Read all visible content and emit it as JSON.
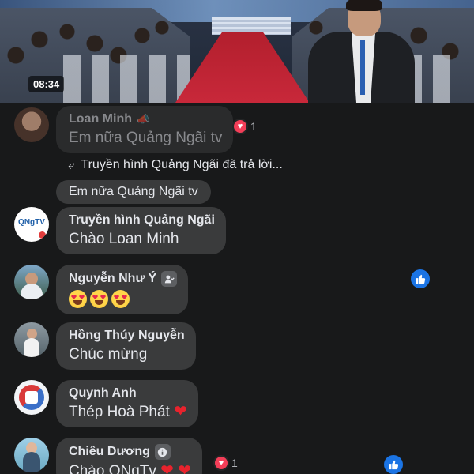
{
  "video": {
    "timestamp": "08:34"
  },
  "comments": [
    {
      "name": "Loan Minh",
      "text": "Em nữa Quảng Ngãi tv",
      "reaction_count": "1"
    },
    {
      "reply_notice": "Truyền hình Quảng Ngãi đã trả lời...",
      "quoted_text": "Em nữa Quảng Ngãi tv"
    },
    {
      "name": "Truyền hình Quảng Ngãi",
      "text": "Chào Loan Minh",
      "avatar_label": "QNgTV"
    },
    {
      "name": "Nguyễn Như Ý",
      "text": ""
    },
    {
      "name": "Hồng Thúy Nguyễn",
      "text": "Chúc mừng"
    },
    {
      "name": "Quynh Anh",
      "text": "Thép Hoà Phát"
    },
    {
      "name": "Chiêu Dương",
      "text": "Chào QNgTv",
      "reaction_count": "1"
    }
  ],
  "icons": {
    "like": "like-icon",
    "heart": "heart-icon",
    "reply": "reply-arrow-icon",
    "info": "info-icon",
    "friend": "friend-icon",
    "badge": "megaphone-icon"
  },
  "colors": {
    "background": "#18191a",
    "bubble": "#3a3b3c",
    "like_blue": "#1b74e4",
    "heart_red": "#f33e58"
  }
}
